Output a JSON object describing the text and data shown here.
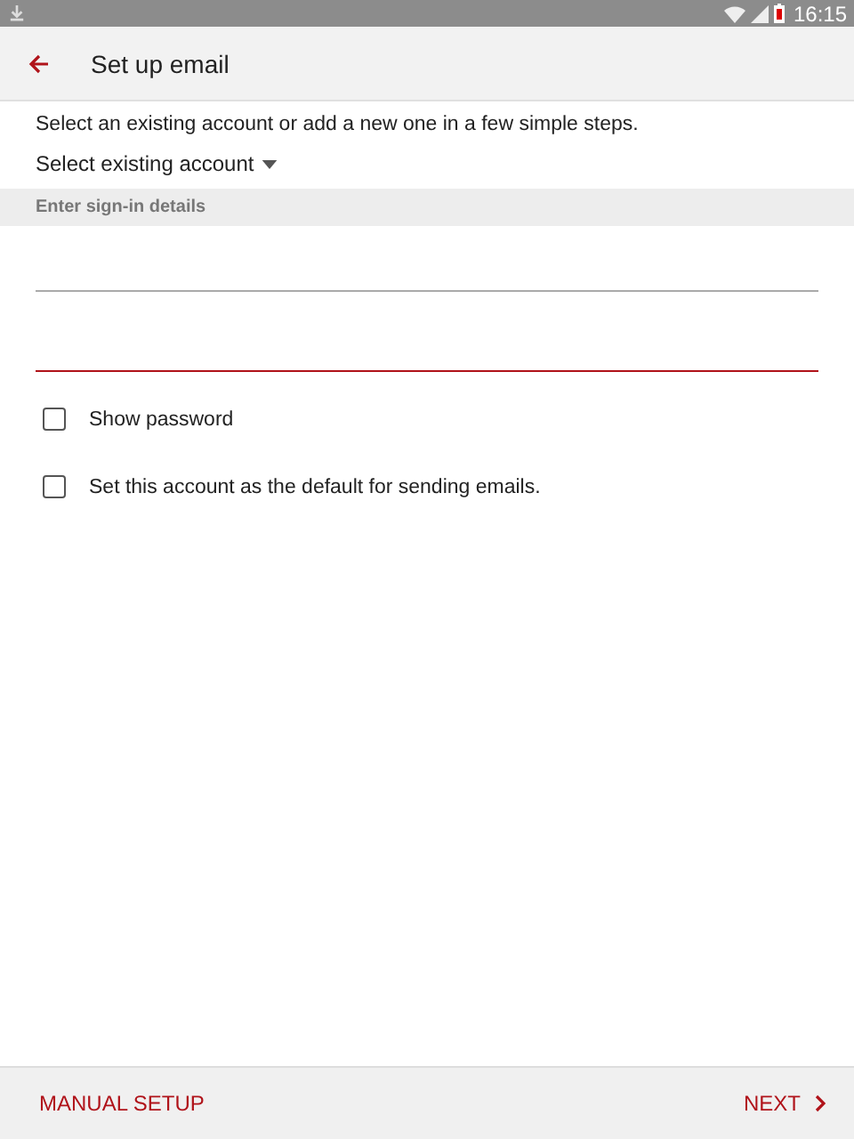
{
  "status_bar": {
    "time": "16:15"
  },
  "header": {
    "title": "Set up email"
  },
  "intro": "Select an existing account or add a new one in a few simple steps.",
  "account_dropdown": {
    "label": "Select existing account"
  },
  "section_header": "Enter sign-in details",
  "fields": [
    {
      "focused": false
    },
    {
      "focused": true
    }
  ],
  "options": [
    {
      "label": "Show password",
      "checked": false
    },
    {
      "label": "Set this account as the default for sending emails.",
      "checked": false
    }
  ],
  "footer": {
    "left_button": "MANUAL SETUP",
    "right_button": "NEXT"
  }
}
